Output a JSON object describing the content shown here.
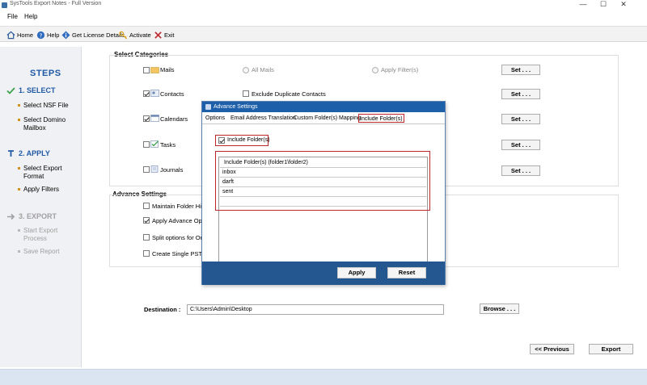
{
  "window": {
    "title": "SysTools Export Notes - Full Version",
    "minimize": "—",
    "maximize": "☐",
    "close": "✕"
  },
  "menu": {
    "file": "File",
    "help": "Help"
  },
  "toolbar": {
    "home": "Home",
    "help": "Help",
    "license": "Get License Details",
    "activate": "Activate",
    "exit": "Exit"
  },
  "steps": {
    "title": "STEPS",
    "select": {
      "label": "1. SELECT",
      "items": [
        "Select NSF File",
        "Select Domino\nMailbox"
      ]
    },
    "apply": {
      "label": "2. APPLY",
      "items": [
        "Select Export\nFormat",
        "Apply Filters"
      ]
    },
    "export": {
      "label": "3. EXPORT",
      "items": [
        "Start Export\nProcess",
        "Save Report"
      ]
    }
  },
  "categories": {
    "title": "Select Categories",
    "mails": "Mails",
    "all_mails": "All Mails",
    "apply_filters": "Apply Filter(s)",
    "contacts": "Contacts",
    "exclude_duplicates": "Exclude Duplicate Contacts",
    "calendars": "Calendars",
    "tasks": "Tasks",
    "journals": "Journals",
    "set_label": "Set . . ."
  },
  "advance": {
    "title": "Advance Settings",
    "maintain": "Maintain Folder Hiera",
    "apply_adv": "Apply Advance Optio",
    "split": "Split options for Outl",
    "single_pst": "Create Single PST File"
  },
  "destination": {
    "label": "Destination :",
    "value": "C:\\Users\\Admin\\Desktop",
    "browse": "Browse . . ."
  },
  "nav": {
    "previous": "<< Previous",
    "export": "Export"
  },
  "dialog": {
    "title": "Advance Settings",
    "tabs": [
      "Options",
      "Email Address Translation",
      "Custom Folder(s) Mapping",
      "Include Folder(s)"
    ],
    "include_checkbox": "Include Folder(s)",
    "grid_header": "Include Folder(s) (folder1\\folder2)",
    "rows": [
      "inbox",
      "darft",
      "sent"
    ],
    "apply": "Apply",
    "reset": "Reset"
  },
  "colors": {
    "accent": "#1f5aa6",
    "dialog_footer": "#24578f",
    "highlight": "#c0272d"
  }
}
